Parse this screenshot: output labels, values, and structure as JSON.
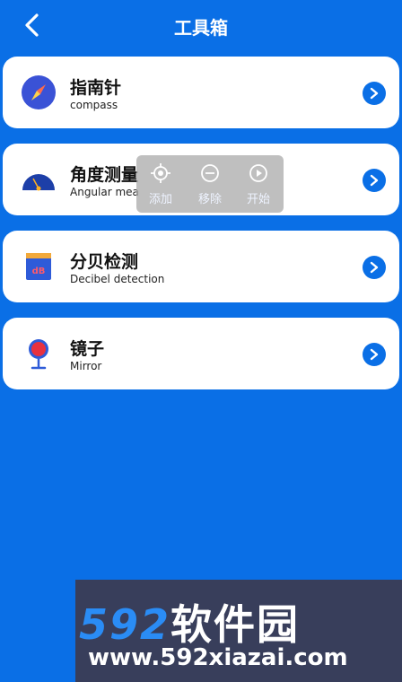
{
  "header": {
    "title": "工具箱"
  },
  "tools": [
    {
      "name": "指南针",
      "sub": "compass"
    },
    {
      "name": "角度测量",
      "sub": "Angular mea"
    },
    {
      "name": "分贝检测",
      "sub": "Decibel detection"
    },
    {
      "name": "镜子",
      "sub": "Mirror"
    }
  ],
  "popup": {
    "add": "添加",
    "remove": "移除",
    "start": "开始"
  },
  "watermark": {
    "number": "592",
    "brand": "软件园",
    "url": "www.592xiazai.com"
  },
  "colors": {
    "background": "#0a6fe6",
    "card": "#ffffff",
    "arrow": "#0a6fe6"
  },
  "icons": {
    "back": "chevron-left-icon",
    "compass": "compass-icon",
    "angle": "protractor-icon",
    "decibel": "decibel-meter-icon",
    "mirror": "mirror-icon",
    "arrow": "chevron-right-circle-icon",
    "add": "crosshair-icon",
    "remove": "minus-circle-icon",
    "start": "play-circle-icon"
  }
}
